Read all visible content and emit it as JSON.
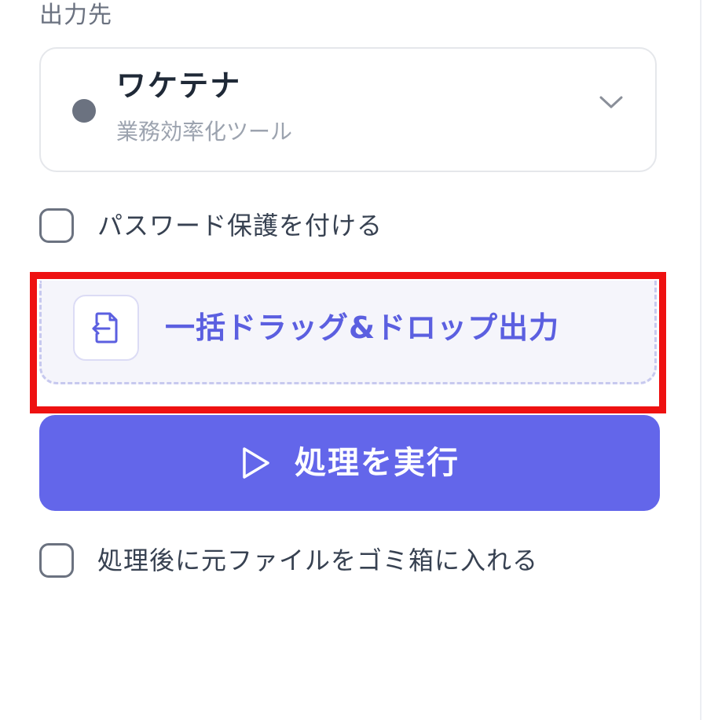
{
  "output_section": {
    "label": "出力先",
    "selected_app": {
      "name": "ワケテナ",
      "subtitle": "業務効率化ツール",
      "dot_color": "#6b7280"
    },
    "chevron_icon": "chevron-down-icon"
  },
  "password_option": {
    "label": "パスワード保護を付ける",
    "checked": false
  },
  "dnd_export": {
    "label": "一括ドラッグ&ドロップ出力",
    "icon": "file-export-icon",
    "color": "#5b5fe0"
  },
  "run_button": {
    "label": "処理を実行",
    "icon": "play-icon",
    "color": "#6366ea"
  },
  "trash_option": {
    "label": "処理後に元ファイルをゴミ箱に入れる",
    "checked": false
  },
  "highlight_color": "#ee1111"
}
